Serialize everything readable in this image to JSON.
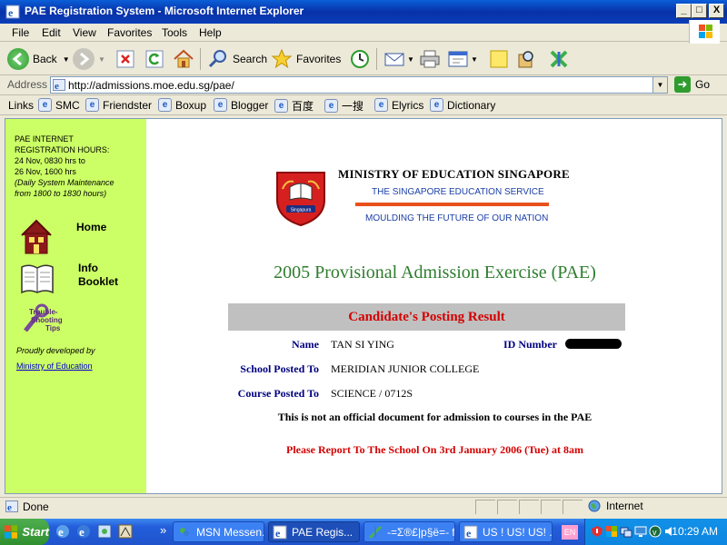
{
  "window": {
    "title": "PAE Registration System - Microsoft Internet Explorer",
    "buttons": {
      "minimize": "_",
      "maximize": "□",
      "close": "X"
    }
  },
  "menu": [
    "File",
    "Edit",
    "View",
    "Favorites",
    "Tools",
    "Help"
  ],
  "toolbar": {
    "back": "Back",
    "search": "Search",
    "favorites": "Favorites"
  },
  "address": {
    "label": "Address",
    "url": "http://admissions.moe.edu.sg/pae/",
    "go": "Go"
  },
  "links": {
    "label": "Links",
    "items": [
      "SMC",
      "Friendster",
      "Boxup",
      "Blogger",
      "百度",
      "一搜",
      "Elyrics",
      "Dictionary"
    ]
  },
  "sidebar": {
    "hours_title_1": "PAE INTERNET",
    "hours_title_2": "REGISTRATION HOURS:",
    "hours_1": "24 Nov, 0830 hrs to",
    "hours_2": "26 Nov, 1600 hrs",
    "maintenance_1": "(Daily System Maintenance",
    "maintenance_2": "from 1800 to 1830 hours)",
    "home": "Home",
    "info_1": "Info",
    "info_2": "Booklet",
    "trouble_1": "Trouble-",
    "trouble_2": "Shooting",
    "trouble_3": "Tips",
    "proud": "Proudly developed by",
    "ministry_link": "Ministry of Education"
  },
  "header": {
    "ministry": "MINISTRY OF EDUCATION SINGAPORE",
    "service": "THE SINGAPORE EDUCATION SERVICE",
    "motto": "MOULDING THE FUTURE OF OUR NATION",
    "crest_motto": "Singapura"
  },
  "main": {
    "heading": "2005 Provisional Admission Exercise (PAE)",
    "result_title": "Candidate's Posting Result",
    "name_label": "Name",
    "name_value": "TAN SI YING",
    "id_label": "ID Number",
    "school_label": "School Posted To",
    "school_value": "MERIDIAN JUNIOR COLLEGE",
    "course_label": "Course Posted To",
    "course_value": "SCIENCE / 0712S",
    "notice": "This is not an official document for admission to courses in the PAE",
    "report": "Please Report To The School On 3rd January 2006 (Tue) at 8am"
  },
  "status": {
    "text": "Done",
    "zone": "Internet"
  },
  "taskbar": {
    "start": "Start",
    "more": "»",
    "tasks": [
      "MSN Messen...",
      "PAE Regis...",
      "-=Σ®£|p§ë=- fr...",
      "US ! US! US! ..."
    ],
    "lang": "EN",
    "clock": "10:29 AM"
  },
  "colors": {
    "sidebar_bg": "#ccff66",
    "heading_green": "#2e7d2e",
    "result_red": "#d40000",
    "label_navy": "#000080",
    "motto_blue": "#1a3ea6",
    "accent_orange": "#e8501c"
  }
}
